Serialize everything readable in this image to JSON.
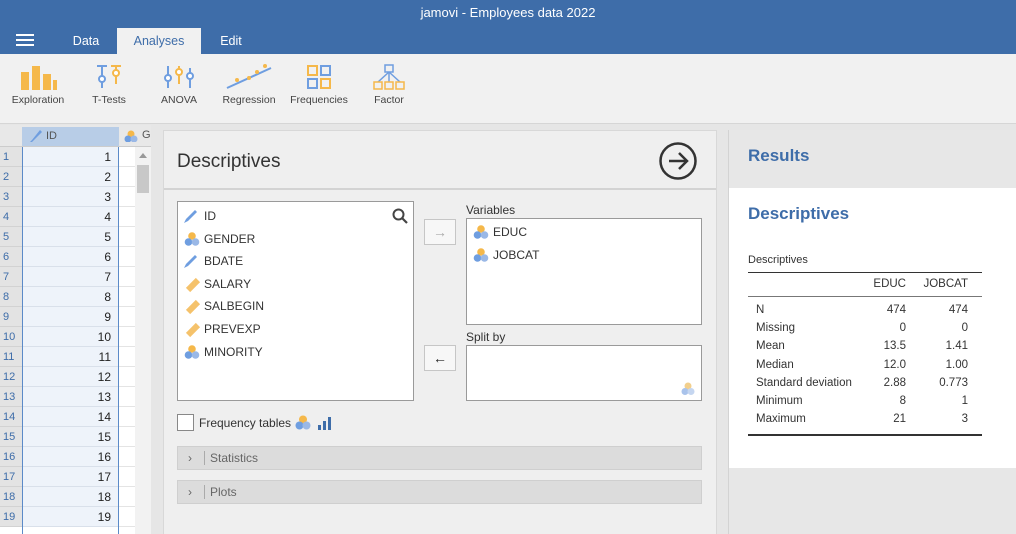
{
  "window": {
    "title": "jamovi - Employees data 2022"
  },
  "tabs": [
    {
      "label": "Data"
    },
    {
      "label": "Analyses"
    },
    {
      "label": "Edit"
    }
  ],
  "ribbon": [
    {
      "label": "Exploration",
      "icon": "exploration-icon"
    },
    {
      "label": "T-Tests",
      "icon": "ttests-icon"
    },
    {
      "label": "ANOVA",
      "icon": "anova-icon"
    },
    {
      "label": "Regression",
      "icon": "regression-icon"
    },
    {
      "label": "Frequencies",
      "icon": "frequencies-icon"
    },
    {
      "label": "Factor",
      "icon": "factor-icon"
    }
  ],
  "spreadsheet": {
    "columns": [
      {
        "name": "ID"
      },
      {
        "name": "G"
      }
    ],
    "rows": [
      "1",
      "2",
      "3",
      "4",
      "5",
      "6",
      "7",
      "8",
      "9",
      "10",
      "11",
      "12",
      "13",
      "14",
      "15",
      "16",
      "17",
      "18",
      "19"
    ],
    "values": [
      "1",
      "2",
      "3",
      "4",
      "5",
      "6",
      "7",
      "8",
      "9",
      "10",
      "11",
      "12",
      "13",
      "14",
      "15",
      "16",
      "17",
      "18",
      "19"
    ]
  },
  "analysis": {
    "title": "Descriptives",
    "available_vars": [
      "ID",
      "GENDER",
      "BDATE",
      "SALARY",
      "SALBEGIN",
      "PREVEXP",
      "MINORITY"
    ],
    "variables_label": "Variables",
    "variables": [
      "EDUC",
      "JOBCAT"
    ],
    "split_label": "Split by",
    "freq_label": "Frequency tables",
    "statistics_label": "Statistics",
    "plots_label": "Plots"
  },
  "results": {
    "title": "Results",
    "heading": "Descriptives",
    "table_title": "Descriptives",
    "columns": [
      "EDUC",
      "JOBCAT"
    ],
    "rows": [
      {
        "label": "N",
        "educ": "474",
        "jobcat": "474"
      },
      {
        "label": "Missing",
        "educ": "0",
        "jobcat": "0"
      },
      {
        "label": "Mean",
        "educ": "13.5",
        "jobcat": "1.41"
      },
      {
        "label": "Median",
        "educ": "12.0",
        "jobcat": "1.00"
      },
      {
        "label": "Standard deviation",
        "educ": "2.88",
        "jobcat": "0.773"
      },
      {
        "label": "Minimum",
        "educ": "8",
        "jobcat": "1"
      },
      {
        "label": "Maximum",
        "educ": "21",
        "jobcat": "3"
      }
    ]
  },
  "colors": {
    "accent": "#3e6da9",
    "nominal": "#f5b84a",
    "continuous": "#f5c26b",
    "id": "#6f9ee0"
  }
}
